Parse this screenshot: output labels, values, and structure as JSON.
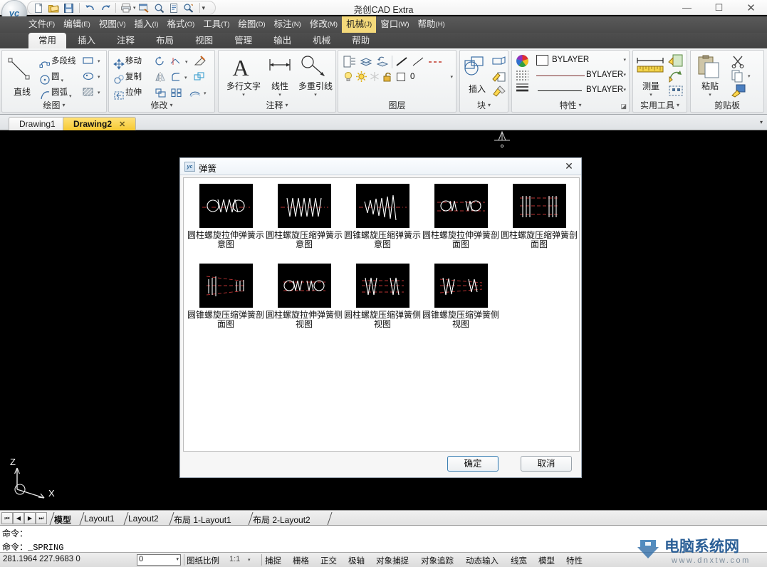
{
  "window": {
    "title": "尧创CAD Extra",
    "minimize": "—",
    "maximize": "☐",
    "close": "✕"
  },
  "quick_access": {
    "icons": [
      "new-icon",
      "open-icon",
      "save-icon",
      "undo-icon",
      "redo-icon",
      "print-icon",
      "print-dropdown",
      "plot-preview-icon",
      "zoom-icon",
      "layout-icon",
      "find-icon",
      "qat-more-icon"
    ]
  },
  "menubar": {
    "items": [
      {
        "label": "文件",
        "key": "(F)"
      },
      {
        "label": "编辑",
        "key": "(E)"
      },
      {
        "label": "视图",
        "key": "(V)"
      },
      {
        "label": "插入",
        "key": "(I)"
      },
      {
        "label": "格式",
        "key": "(O)"
      },
      {
        "label": "工具",
        "key": "(T)"
      },
      {
        "label": "绘图",
        "key": "(D)"
      },
      {
        "label": "标注",
        "key": "(N)"
      },
      {
        "label": "修改",
        "key": "(M)"
      },
      {
        "label": "机械",
        "key": "(J)",
        "highlighted": true
      },
      {
        "label": "窗口",
        "key": "(W)"
      },
      {
        "label": "帮助",
        "key": "(H)"
      }
    ]
  },
  "ribbon": {
    "tabs": [
      "常用",
      "插入",
      "注释",
      "布局",
      "视图",
      "管理",
      "输出",
      "机械",
      "帮助"
    ],
    "active_tab": "常用",
    "panels": {
      "draw": {
        "title": "绘图",
        "big_button": "直线",
        "items": [
          "多段线",
          "圆",
          "圆弧"
        ],
        "right_icons": [
          "rectangle-icon",
          "ellipse-icon",
          "hatch-icon"
        ]
      },
      "modify": {
        "title": "修改",
        "items": [
          "移动",
          "复制",
          "拉伸"
        ],
        "right_icons": [
          "rotate-icon",
          "trim-icon",
          "erase-icon",
          "mirror-icon",
          "fillet-icon",
          "explode-icon",
          "scale-icon",
          "array-icon",
          "offset-icon"
        ]
      },
      "annotation": {
        "title": "注释",
        "buttons": [
          "多行文字",
          "线性",
          "多重引线"
        ]
      },
      "layers": {
        "title": "图层",
        "current_layer": "0",
        "tool_icons": [
          "layer-properties-icon",
          "layer-state-icon",
          "layer-previous-icon",
          "line-icon",
          "line2-icon",
          "dashed-icon"
        ],
        "state_icons": [
          "lightbulb-icon",
          "sun-icon",
          "freeze-icon",
          "unlock-icon",
          "color-swatch-icon"
        ]
      },
      "block": {
        "title": "块",
        "big_button": "插入",
        "icons": [
          "create-block-icon",
          "edit-block-icon",
          "attribute-icon"
        ]
      },
      "properties": {
        "title": "特性",
        "rows": [
          {
            "icon": "color-wheel-icon",
            "value": "BYLAYER"
          },
          {
            "icon": "linetype-icon",
            "value": "BYLAYER"
          },
          {
            "icon": "lineweight-icon",
            "value": "BYLAYER"
          }
        ]
      },
      "utilities": {
        "title": "实用工具",
        "big_button": "测量",
        "icons": [
          "quick-select-icon",
          "quick-calc-icon",
          "select-all-icon"
        ]
      },
      "clipboard": {
        "title": "剪贴板",
        "big_button": "粘贴",
        "icons": [
          "cut-icon",
          "copy-icon",
          "match-properties-icon"
        ]
      }
    }
  },
  "drawing_tabs": {
    "tabs": [
      {
        "label": "Drawing1",
        "active": false,
        "closable": false
      },
      {
        "label": "Drawing2",
        "active": true,
        "closable": true,
        "close": "✕"
      }
    ],
    "overflow_caret": "▾"
  },
  "dialog": {
    "title": "弹簧",
    "icon": "yc-app-icon",
    "close": "✕",
    "items": [
      {
        "label": "圆柱螺旋拉伸弹簧示意图",
        "thumb": "cylindrical-extension-spring-schematic"
      },
      {
        "label": "圆柱螺旋压缩弹簧示意图",
        "thumb": "cylindrical-compression-spring-schematic"
      },
      {
        "label": "圆锥螺旋压缩弹簧示意图",
        "thumb": "conical-compression-spring-schematic"
      },
      {
        "label": "圆柱螺旋拉伸弹簧剖面图",
        "thumb": "cylindrical-extension-spring-section"
      },
      {
        "label": "圆柱螺旋压缩弹簧剖面图",
        "thumb": "cylindrical-compression-spring-section"
      },
      {
        "label": "圆锥螺旋压缩弹簧剖面图",
        "thumb": "conical-compression-spring-section"
      },
      {
        "label": "圆柱螺旋拉伸弹簧侧视图",
        "thumb": "cylindrical-extension-spring-side"
      },
      {
        "label": "圆柱螺旋压缩弹簧侧视图",
        "thumb": "cylindrical-compression-spring-side"
      },
      {
        "label": "圆锥螺旋压缩弹簧侧视图",
        "thumb": "conical-compression-spring-side"
      }
    ],
    "ok_label": "确定",
    "cancel_label": "取消"
  },
  "canvas": {
    "ucs_z": "Z",
    "ucs_x": "X"
  },
  "layout_bar": {
    "nav": [
      "⏮",
      "◀",
      "▶",
      "⏭"
    ],
    "tabs": [
      "模型",
      "Layout1",
      "Layout2",
      "布局 1-Layout1",
      "布局 2-Layout2"
    ],
    "active": "模型"
  },
  "command_line": {
    "line1": "命令：",
    "line2": "命令：_SPRING"
  },
  "status_bar": {
    "coordinates": "281.1964 227.9683 0",
    "snap_combo": "0",
    "scale_label": "图纸比例",
    "scale_value": "1:1",
    "toggles": [
      "捕捉",
      "栅格",
      "正交",
      "极轴",
      "对象捕捉",
      "对象追踪",
      "动态输入",
      "线宽",
      "模型",
      "特性"
    ]
  },
  "watermark": {
    "text": "电脑系统网",
    "url": "www.dnxtw.com"
  }
}
